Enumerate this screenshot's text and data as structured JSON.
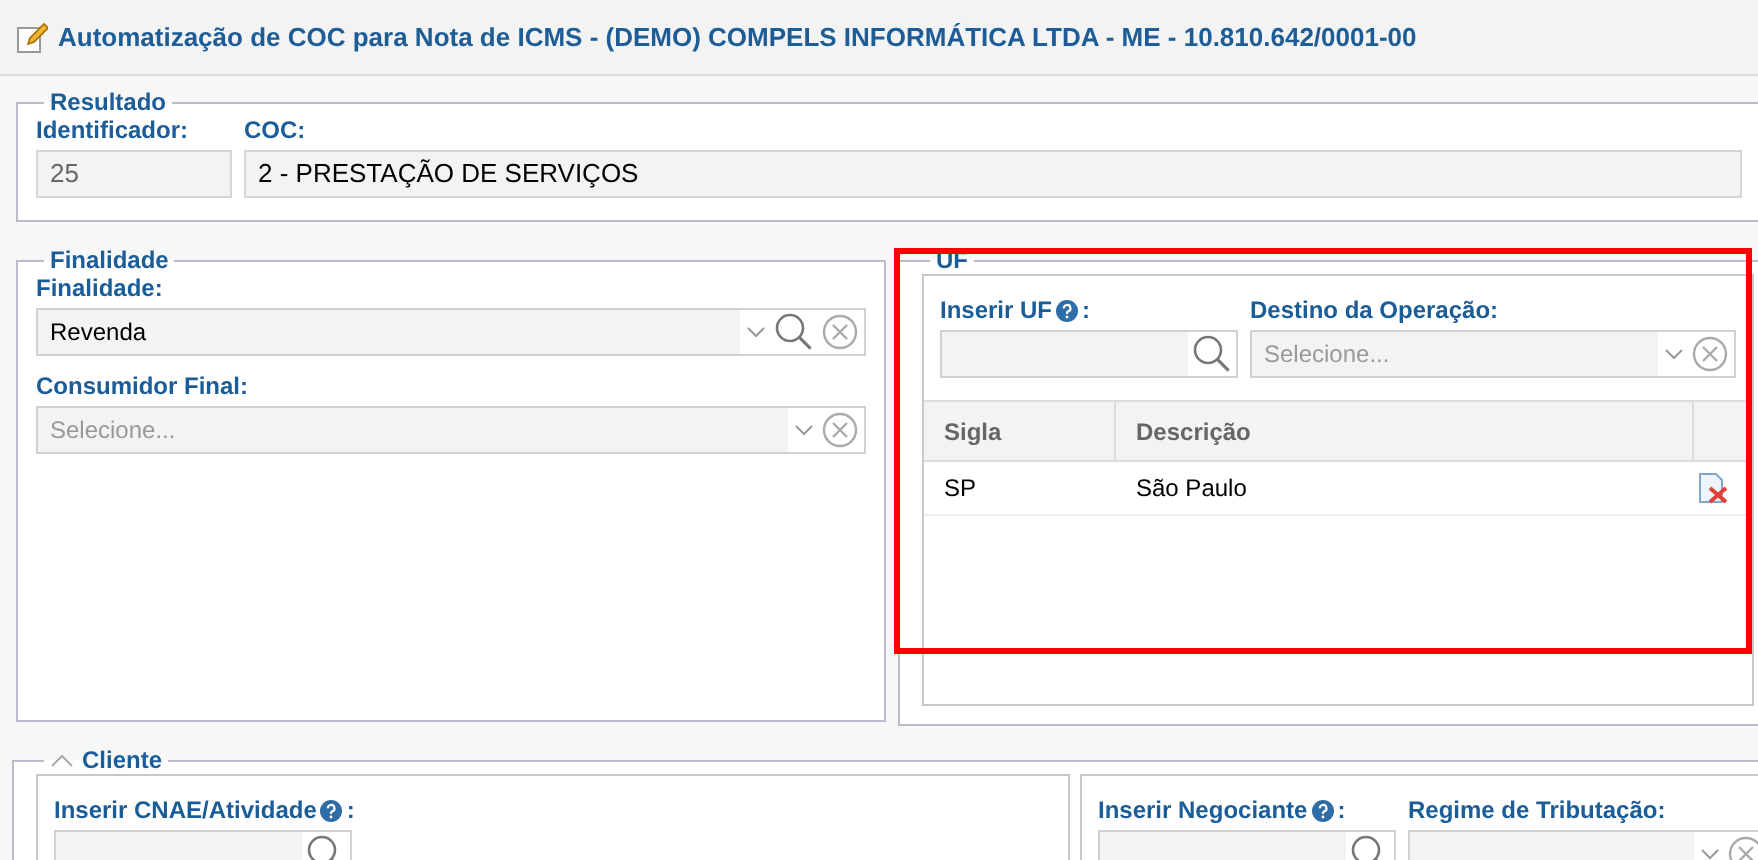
{
  "window": {
    "title": "Automatização de COC para Nota de ICMS - (DEMO) COMPELS INFORMÁTICA LTDA - ME - 10.810.642/0001-00"
  },
  "resultado": {
    "legend": "Resultado",
    "fields": [
      {
        "label": "Identificador:",
        "value": "25"
      },
      {
        "label": "COC:",
        "value": "2 - PRESTAÇÃO DE SERVIÇOS"
      }
    ]
  },
  "finalidade": {
    "legend": "Finalidade",
    "fields": [
      {
        "label": "Finalidade:",
        "value": "Revenda",
        "search": true
      },
      {
        "label": "Consumidor Final:",
        "placeholder": "Selecione...",
        "search": false
      }
    ]
  },
  "uf": {
    "legend": "UF",
    "highlighted": true,
    "insert_label": {
      "text": "Inserir UF",
      "suffix": ":"
    },
    "destino": {
      "label": "Destino da Operação:",
      "placeholder": "Selecione..."
    },
    "table": {
      "columns": [
        "Sigla",
        "Descrição"
      ],
      "rows": [
        [
          "SP",
          "São Paulo"
        ]
      ]
    }
  },
  "cliente": {
    "legend": "Cliente",
    "expanded": true,
    "cnae_label": {
      "text": "Inserir CNAE/Atividade",
      "suffix": ":"
    },
    "negociante_label": {
      "text": "Inserir Negociante",
      "suffix": ":"
    },
    "regime_label": "Regime de Tributação:"
  }
}
